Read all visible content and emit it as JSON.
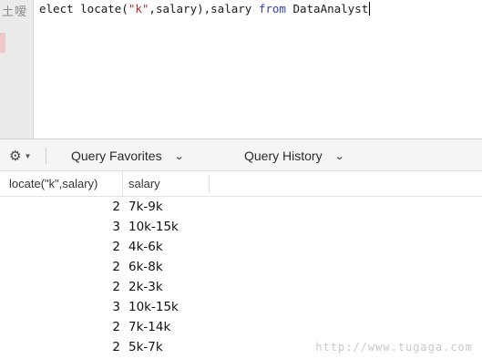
{
  "gutter": {
    "watermark_text": "土嗳"
  },
  "editor": {
    "sql_tokens": {
      "t1": "elect locate(",
      "t2": "\"k\"",
      "t3": ",salary),salary ",
      "t4": "from",
      "t5": " DataAnalyst"
    }
  },
  "toolbar": {
    "settings_icon": "gear-icon",
    "favorites_label": "Query Favorites",
    "history_label": "Query History",
    "chevron": "⌄"
  },
  "results": {
    "columns": [
      "locate(\"k\",salary)",
      "salary"
    ],
    "rows": [
      [
        "2",
        "7k-9k"
      ],
      [
        "3",
        "10k-15k"
      ],
      [
        "2",
        "4k-6k"
      ],
      [
        "2",
        "6k-8k"
      ],
      [
        "2",
        "2k-3k"
      ],
      [
        "3",
        "10k-15k"
      ],
      [
        "2",
        "7k-14k"
      ],
      [
        "2",
        "5k-7k"
      ]
    ]
  },
  "watermark": "http://www.tugaga.com"
}
